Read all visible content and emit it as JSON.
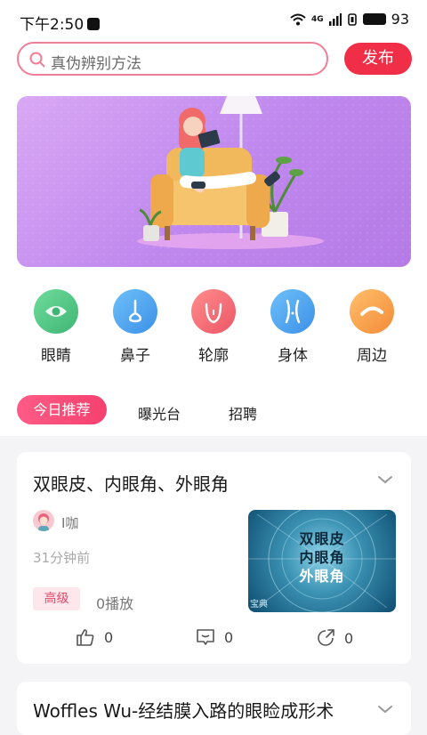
{
  "status": {
    "time": "下午2:50",
    "battery": "93",
    "network": "4G"
  },
  "search": {
    "placeholder": "真伪辨别方法"
  },
  "publish_label": "发布",
  "categories": [
    {
      "label": "眼睛",
      "color": "#54c98b",
      "icon": "eye-icon"
    },
    {
      "label": "鼻子",
      "color": "#4aa3ee",
      "icon": "nose-icon"
    },
    {
      "label": "轮廓",
      "color": "#f26e78",
      "icon": "face-contour-icon"
    },
    {
      "label": "身体",
      "color": "#4aa3ee",
      "icon": "body-icon"
    },
    {
      "label": "周边",
      "color": "#f6a14d",
      "icon": "eyebrow-icon"
    }
  ],
  "tabs": [
    "今日推荐",
    "曝光台",
    "招聘"
  ],
  "cards": [
    {
      "title": "双眼皮、内眼角、外眼角",
      "author": "I咖",
      "time": "31分钟前",
      "badge": "高级",
      "plays": "0播放",
      "thumb_lines": [
        "双眼皮",
        "内眼角",
        "外眼角"
      ],
      "thumb_corner": "宝典",
      "likes": "0",
      "comments": "0",
      "shares": "0"
    },
    {
      "title": "Woffles Wu-经结膜入路的眼睑成形术"
    }
  ],
  "colors": {
    "accent": "#f02e47",
    "tab_gradient": "#ff5b86",
    "banner": "#c089ee"
  }
}
